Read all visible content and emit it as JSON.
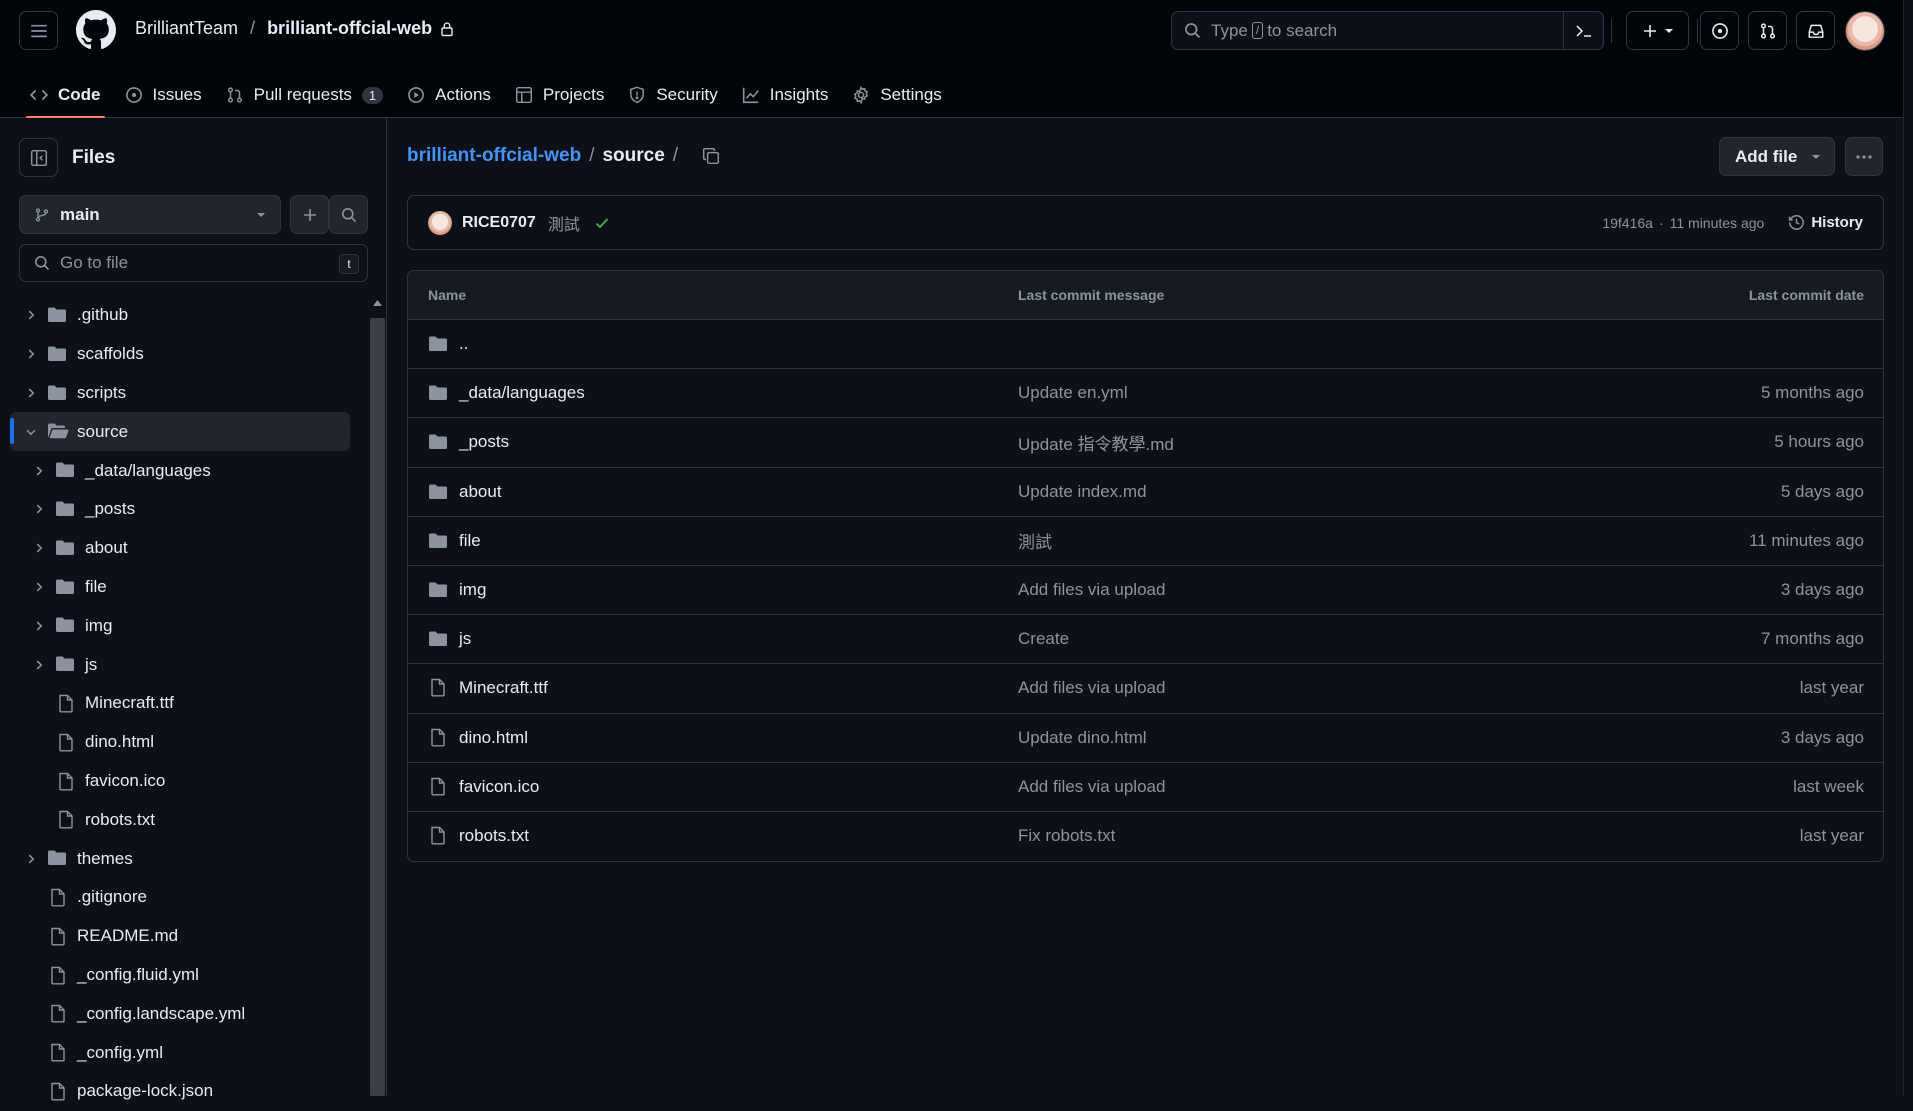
{
  "header": {
    "owner": "BrilliantTeam",
    "separator": "/",
    "repo": "brilliant-offcial-web",
    "search_prefix": "Type",
    "search_key": "/",
    "search_suffix": "to search"
  },
  "tabs": [
    {
      "label": "Code",
      "icon": "code-icon",
      "active": true
    },
    {
      "label": "Issues",
      "icon": "issue-icon"
    },
    {
      "label": "Pull requests",
      "icon": "pull-request-icon",
      "count": "1"
    },
    {
      "label": "Actions",
      "icon": "play-icon"
    },
    {
      "label": "Projects",
      "icon": "table-icon"
    },
    {
      "label": "Security",
      "icon": "shield-icon"
    },
    {
      "label": "Insights",
      "icon": "graph-icon"
    },
    {
      "label": "Settings",
      "icon": "gear-icon"
    }
  ],
  "sidebar": {
    "title": "Files",
    "branch": "main",
    "goto_placeholder": "Go to file",
    "goto_key": "t",
    "tree": [
      {
        "label": ".github",
        "type": "folder",
        "level": 0,
        "expanded": false
      },
      {
        "label": "scaffolds",
        "type": "folder",
        "level": 0,
        "expanded": false
      },
      {
        "label": "scripts",
        "type": "folder",
        "level": 0,
        "expanded": false
      },
      {
        "label": "source",
        "type": "folder",
        "level": 0,
        "expanded": true,
        "selected": true
      },
      {
        "label": "_data/languages",
        "type": "folder",
        "level": 1,
        "expanded": false
      },
      {
        "label": "_posts",
        "type": "folder",
        "level": 1,
        "expanded": false
      },
      {
        "label": "about",
        "type": "folder",
        "level": 1,
        "expanded": false
      },
      {
        "label": "file",
        "type": "folder",
        "level": 1,
        "expanded": false
      },
      {
        "label": "img",
        "type": "folder",
        "level": 1,
        "expanded": false
      },
      {
        "label": "js",
        "type": "folder",
        "level": 1,
        "expanded": false
      },
      {
        "label": "Minecraft.ttf",
        "type": "file",
        "level": 1
      },
      {
        "label": "dino.html",
        "type": "file",
        "level": 1
      },
      {
        "label": "favicon.ico",
        "type": "file",
        "level": 1
      },
      {
        "label": "robots.txt",
        "type": "file",
        "level": 1
      },
      {
        "label": "themes",
        "type": "folder",
        "level": 0,
        "expanded": false
      },
      {
        "label": ".gitignore",
        "type": "file",
        "level": 0
      },
      {
        "label": "README.md",
        "type": "file",
        "level": 0
      },
      {
        "label": "_config.fluid.yml",
        "type": "file",
        "level": 0
      },
      {
        "label": "_config.landscape.yml",
        "type": "file",
        "level": 0
      },
      {
        "label": "_config.yml",
        "type": "file",
        "level": 0
      },
      {
        "label": "package-lock.json",
        "type": "file",
        "level": 0
      }
    ]
  },
  "main": {
    "path_root": "brilliant-offcial-web",
    "path_sep": "/",
    "path_current": "source",
    "add_file_label": "Add file",
    "commit": {
      "author": "RICE0707",
      "message": "測試",
      "sha": "19f416a",
      "dot": "·",
      "time": "11 minutes ago",
      "history_label": "History"
    },
    "columns": {
      "name": "Name",
      "message": "Last commit message",
      "date": "Last commit date"
    },
    "parent_label": "..",
    "files": [
      {
        "name": "_data/languages",
        "type": "folder",
        "message": "Update en.yml",
        "date": "5 months ago"
      },
      {
        "name": "_posts",
        "type": "folder",
        "message": "Update 指令教學.md",
        "date": "5 hours ago"
      },
      {
        "name": "about",
        "type": "folder",
        "message": "Update index.md",
        "date": "5 days ago"
      },
      {
        "name": "file",
        "type": "folder",
        "message": "測試",
        "date": "11 minutes ago"
      },
      {
        "name": "img",
        "type": "folder",
        "message": "Add files via upload",
        "date": "3 days ago"
      },
      {
        "name": "js",
        "type": "folder",
        "message": "Create",
        "date": "7 months ago"
      },
      {
        "name": "Minecraft.ttf",
        "type": "file",
        "message": "Add files via upload",
        "date": "last year"
      },
      {
        "name": "dino.html",
        "type": "file",
        "message": "Update dino.html",
        "date": "3 days ago"
      },
      {
        "name": "favicon.ico",
        "type": "file",
        "message": "Add files via upload",
        "date": "last week"
      },
      {
        "name": "robots.txt",
        "type": "file",
        "message": "Fix robots.txt",
        "date": "last year"
      }
    ]
  },
  "colors": {
    "bg": "#0d1117",
    "header_bg": "#010409",
    "border": "#30363d",
    "accent_link": "#4493f8",
    "tab_underline": "#f78166",
    "selected_bar": "#1f6feb",
    "success": "#3fb950",
    "muted": "#8b949e"
  }
}
